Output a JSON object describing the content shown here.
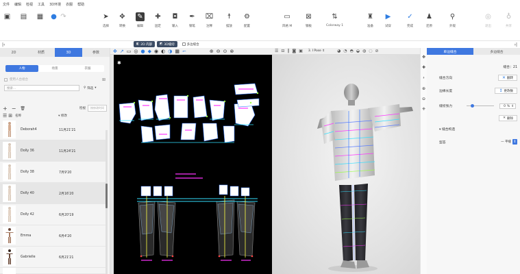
{
  "menu": [
    "文件",
    "编辑",
    "检视",
    "工具",
    "3D环境",
    "衣服",
    "帮助"
  ],
  "toolbar": {
    "items": [
      {
        "label": "选择",
        "icon": "arrow-select-icon"
      },
      {
        "label": "转换",
        "icon": "transform-icon"
      },
      {
        "label": "编辑",
        "icon": "edit-pattern-icon"
      },
      {
        "label": "固定",
        "icon": "pin-icon"
      },
      {
        "label": "输入",
        "icon": "input-icon"
      },
      {
        "label": "钢笔",
        "icon": "pen-icon"
      },
      {
        "label": "注释",
        "icon": "note-icon"
      },
      {
        "label": "摆放",
        "icon": "arrange-icon"
      },
      {
        "label": "配置",
        "icon": "settings-icon"
      },
      {
        "label": "风格 M",
        "icon": "style-icon"
      },
      {
        "label": "钢板",
        "icon": "board-icon"
      },
      {
        "label": "Colorway 1",
        "icon": "colorway-icon"
      },
      {
        "label": "准备",
        "icon": "prepare-icon"
      },
      {
        "label": "试穿",
        "icon": "play-simulation-icon"
      },
      {
        "label": "完成",
        "icon": "check-icon"
      },
      {
        "label": "还原",
        "icon": "undo-icon"
      },
      {
        "label": "外观",
        "icon": "appearance-icon"
      },
      {
        "label": "退出",
        "icon": "exit-icon"
      },
      {
        "label": "共享",
        "icon": "share-icon"
      }
    ]
  },
  "mode_chips": {
    "pattern": "2D  内部",
    "sync": "3D缝纫",
    "multi": "多边缝合"
  },
  "left": {
    "tabs": [
      "2D",
      "材质",
      "3D",
      "参数"
    ],
    "active_tab": "3D",
    "sub_tabs": [
      "人物",
      "场景",
      "衣服"
    ],
    "active_sub_tab": "人物",
    "relation_label": "使用人台组合",
    "search_placeholder": "搜索...",
    "filter_label": "筛选",
    "sort_label": "检视",
    "sort_select": "按修改时间",
    "col_name": "名称",
    "col_modified": "修改",
    "avatars": [
      {
        "name": "Deborah4",
        "date": "11月21'21"
      },
      {
        "name": "Dolly 36",
        "date": "11月24'21"
      },
      {
        "name": "Dolly 38",
        "date": "7月9'20"
      },
      {
        "name": "Dolly 40",
        "date": "2月16'20"
      },
      {
        "name": "Dolly 42",
        "date": "6月20'19"
      },
      {
        "name": "Emma",
        "date": "6月4'20"
      },
      {
        "name": "Gabrielle",
        "date": "6月21'21"
      }
    ]
  },
  "view3d": {
    "pose_label": "3. I Pose"
  },
  "right": {
    "tabs": [
      "单边缝合",
      "多边缝合"
    ],
    "active_tab": "单边缝合",
    "seam_title": "缝合：21",
    "fold_direction_label": "缝合方向",
    "flip_button": "翻转",
    "edge_length_label": "边缘长度",
    "swap_button": "更改数",
    "tension_label": "缝纫张力",
    "tension_value": "0",
    "tension_unit": "%",
    "delete_button": "删除",
    "section_title": "缝合构造",
    "fold_label": "型态",
    "fold_value": "一 平缝"
  }
}
